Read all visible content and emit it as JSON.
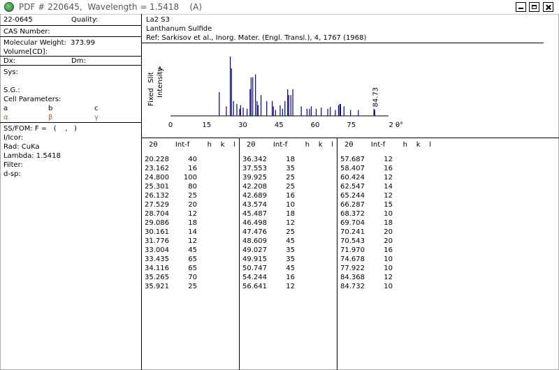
{
  "window": {
    "title": "PDF # 220645,  Wavelength = 1.5418    (A)"
  },
  "card": {
    "pdf_number": "22-0645",
    "quality_label": "Quality:",
    "cas_label": "CAS Number:",
    "molecular_weight_label": "Molecular Weight:",
    "molecular_weight": "373.99",
    "volume_label": "Volume[CD]:",
    "dx_label": "Dx:",
    "dm_label": "Dm:",
    "sys_label": "Sys:",
    "sg_label": "S.G.:",
    "cell_label": "Cell Parameters:",
    "cell_a": "a",
    "cell_b": "b",
    "cell_c": "c",
    "cell_alpha": "α",
    "cell_beta": "β",
    "cell_gamma": "γ",
    "ssfom": "SS/FOM: F =   (    ,   )",
    "icor": "I/Icor:",
    "rad": "Rad: CuKa",
    "lambda": "Lambda: 1.5418",
    "filter": "Filter:",
    "dsp": "d-sp:",
    "formula": "La2 S3",
    "name": "Lanthanum Sulfide",
    "ref": "Ref: Sarkisov et al., Inorg. Mater. (Engl. Transl.), 4, 1767 (1968)"
  },
  "chart_data": {
    "type": "bar",
    "ylabel_1": "Fixed",
    "ylabel_2": "Slit",
    "ylabel_3": "Intensity",
    "ylabel_arrow": "->",
    "xlabel": "2 θ°",
    "xlim": [
      0,
      90
    ],
    "ylim": [
      0,
      100
    ],
    "xticks": [
      "0",
      "15",
      "30",
      "45",
      "60",
      "75"
    ],
    "max_label": "84.73",
    "peaks": [
      {
        "x": 20.228,
        "y": 40
      },
      {
        "x": 23.162,
        "y": 16
      },
      {
        "x": 24.8,
        "y": 100
      },
      {
        "x": 25.301,
        "y": 80
      },
      {
        "x": 26.132,
        "y": 25
      },
      {
        "x": 27.529,
        "y": 20
      },
      {
        "x": 28.704,
        "y": 12
      },
      {
        "x": 29.086,
        "y": 18
      },
      {
        "x": 30.161,
        "y": 14
      },
      {
        "x": 31.776,
        "y": 12
      },
      {
        "x": 33.004,
        "y": 45
      },
      {
        "x": 33.435,
        "y": 65
      },
      {
        "x": 34.116,
        "y": 65
      },
      {
        "x": 35.265,
        "y": 70
      },
      {
        "x": 35.921,
        "y": 25
      },
      {
        "x": 36.342,
        "y": 18
      },
      {
        "x": 37.553,
        "y": 35
      },
      {
        "x": 39.925,
        "y": 25
      },
      {
        "x": 42.208,
        "y": 25
      },
      {
        "x": 42.689,
        "y": 16
      },
      {
        "x": 43.574,
        "y": 10
      },
      {
        "x": 45.487,
        "y": 18
      },
      {
        "x": 46.498,
        "y": 12
      },
      {
        "x": 47.476,
        "y": 25
      },
      {
        "x": 48.609,
        "y": 45
      },
      {
        "x": 49.027,
        "y": 35
      },
      {
        "x": 49.915,
        "y": 35
      },
      {
        "x": 50.747,
        "y": 45
      },
      {
        "x": 54.244,
        "y": 16
      },
      {
        "x": 56.641,
        "y": 12
      },
      {
        "x": 57.687,
        "y": 12
      },
      {
        "x": 58.407,
        "y": 16
      },
      {
        "x": 60.424,
        "y": 12
      },
      {
        "x": 62.547,
        "y": 14
      },
      {
        "x": 65.244,
        "y": 12
      },
      {
        "x": 66.287,
        "y": 15
      },
      {
        "x": 68.372,
        "y": 10
      },
      {
        "x": 69.704,
        "y": 18
      },
      {
        "x": 70.241,
        "y": 20
      },
      {
        "x": 70.543,
        "y": 20
      },
      {
        "x": 71.97,
        "y": 16
      },
      {
        "x": 74.678,
        "y": 10
      },
      {
        "x": 77.922,
        "y": 10
      },
      {
        "x": 84.368,
        "y": 12
      },
      {
        "x": 84.732,
        "y": 10
      }
    ],
    "bar_color": "#00007f"
  },
  "table": {
    "header": "2θ        Int-f        h    k    l",
    "columns": [
      [
        {
          "t": "20.228",
          "i": "40"
        },
        {
          "t": "23.162",
          "i": "16"
        },
        {
          "t": "24.800",
          "i": "100"
        },
        {
          "t": "25.301",
          "i": "80"
        },
        {
          "t": "26.132",
          "i": "25"
        },
        {
          "t": "27.529",
          "i": "20"
        },
        {
          "t": "28.704",
          "i": "12"
        },
        {
          "t": "29.086",
          "i": "18"
        },
        {
          "t": "30.161",
          "i": "14"
        },
        {
          "t": "31.776",
          "i": "12"
        },
        {
          "t": "33.004",
          "i": "45"
        },
        {
          "t": "33.435",
          "i": "65"
        },
        {
          "t": "34.116",
          "i": "65"
        },
        {
          "t": "35.265",
          "i": "70"
        },
        {
          "t": "35.921",
          "i": "25"
        }
      ],
      [
        {
          "t": "36.342",
          "i": "18"
        },
        {
          "t": "37.553",
          "i": "35"
        },
        {
          "t": "39.925",
          "i": "25"
        },
        {
          "t": "42.208",
          "i": "25"
        },
        {
          "t": "42.689",
          "i": "16"
        },
        {
          "t": "43.574",
          "i": "10"
        },
        {
          "t": "45.487",
          "i": "18"
        },
        {
          "t": "46.498",
          "i": "12"
        },
        {
          "t": "47.476",
          "i": "25"
        },
        {
          "t": "48.609",
          "i": "45"
        },
        {
          "t": "49.027",
          "i": "35"
        },
        {
          "t": "49.915",
          "i": "35"
        },
        {
          "t": "50.747",
          "i": "45"
        },
        {
          "t": "54.244",
          "i": "16"
        },
        {
          "t": "56.641",
          "i": "12"
        }
      ],
      [
        {
          "t": "57.687",
          "i": "12"
        },
        {
          "t": "58.407",
          "i": "16"
        },
        {
          "t": "60.424",
          "i": "12"
        },
        {
          "t": "62.547",
          "i": "14"
        },
        {
          "t": "65.244",
          "i": "12"
        },
        {
          "t": "66.287",
          "i": "15"
        },
        {
          "t": "68.372",
          "i": "10"
        },
        {
          "t": "69.704",
          "i": "18"
        },
        {
          "t": "70.241",
          "i": "20"
        },
        {
          "t": "70.543",
          "i": "20"
        },
        {
          "t": "71.970",
          "i": "16"
        },
        {
          "t": "74.678",
          "i": "10"
        },
        {
          "t": "77.922",
          "i": "10"
        },
        {
          "t": "84.368",
          "i": "12"
        },
        {
          "t": "84.732",
          "i": "10"
        }
      ]
    ]
  }
}
